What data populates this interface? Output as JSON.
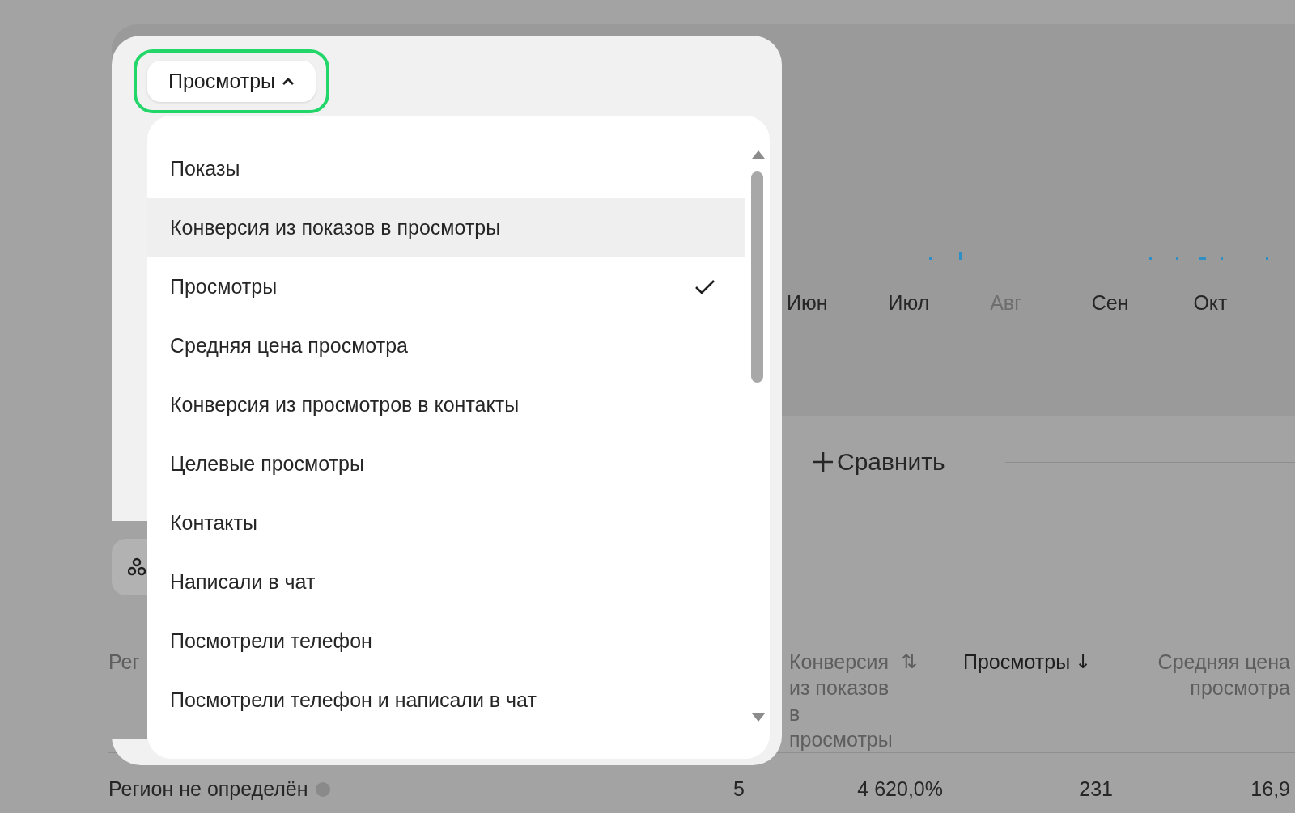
{
  "chart": {
    "months": [
      {
        "label": "Июн",
        "faded": false
      },
      {
        "label": "Июл",
        "faded": false
      },
      {
        "label": "Авг",
        "faded": true
      },
      {
        "label": "Сен",
        "faded": false
      },
      {
        "label": "Окт",
        "faded": false
      }
    ]
  },
  "compare_button": {
    "label": "Сравнить"
  },
  "table": {
    "columns": [
      {
        "label": "Рег",
        "active": false
      },
      null,
      {
        "label": "Конверсия из показов в просмотры",
        "sort_mark": "⇅",
        "active": false
      },
      {
        "label": "Просмотры",
        "sort_mark": "↓",
        "active": true
      },
      {
        "label": "Средняя цена просмотра",
        "active": false
      }
    ],
    "rows": [
      {
        "cells": [
          "Регион не определён",
          "5",
          "4 620,0%",
          "231",
          "16,9"
        ],
        "info": true
      }
    ]
  },
  "metric_dropdown": {
    "label": "Просмотры",
    "expanded": true,
    "options": [
      {
        "label": "Показы",
        "selected": false,
        "highlighted": false
      },
      {
        "label": "Конверсия из показов в просмотры",
        "selected": false,
        "highlighted": true
      },
      {
        "label": "Просмотры",
        "selected": true,
        "highlighted": false
      },
      {
        "label": "Средняя цена просмотра",
        "selected": false,
        "highlighted": false
      },
      {
        "label": "Конверсия из просмотров в контакты",
        "selected": false,
        "highlighted": false
      },
      {
        "label": "Целевые просмотры",
        "selected": false,
        "highlighted": false
      },
      {
        "label": "Контакты",
        "selected": false,
        "highlighted": false
      },
      {
        "label": "Написали в чат",
        "selected": false,
        "highlighted": false
      },
      {
        "label": "Посмотрели телефон",
        "selected": false,
        "highlighted": false
      },
      {
        "label": "Посмотрели телефон и написали в чат",
        "selected": false,
        "highlighted": false
      }
    ]
  }
}
